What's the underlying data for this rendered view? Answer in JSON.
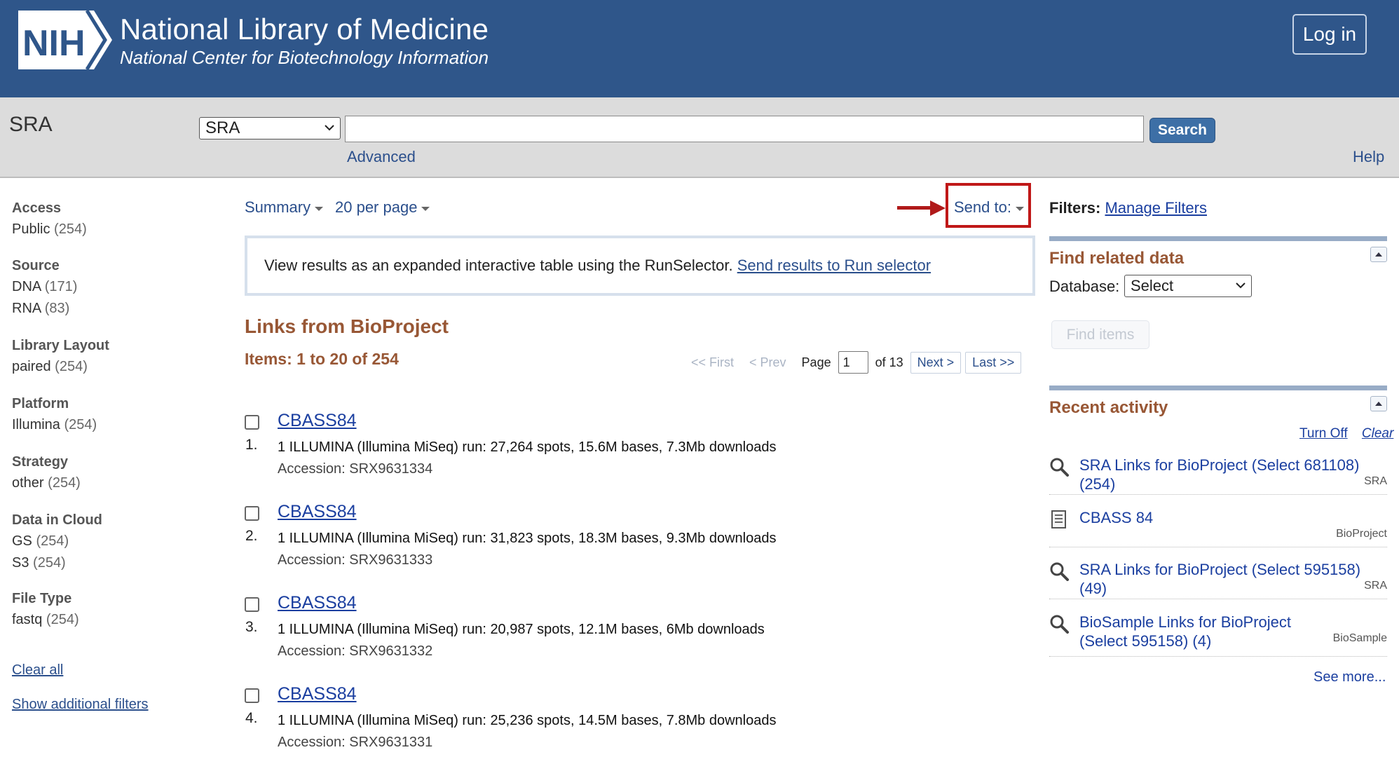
{
  "header": {
    "logo_text": "NIH",
    "title": "National Library of Medicine",
    "subtitle": "National Center for Biotechnology Information",
    "login_label": "Log in"
  },
  "search": {
    "db_heading": "SRA",
    "db_selected": "SRA",
    "query_value": "",
    "search_label": "Search",
    "advanced_label": "Advanced",
    "help_label": "Help"
  },
  "filters": [
    {
      "title": "Access",
      "items": [
        {
          "label": "Public",
          "count": "(254)"
        }
      ]
    },
    {
      "title": "Source",
      "items": [
        {
          "label": "DNA",
          "count": "(171)"
        },
        {
          "label": "RNA",
          "count": "(83)"
        }
      ]
    },
    {
      "title": "Library Layout",
      "items": [
        {
          "label": "paired",
          "count": "(254)"
        }
      ]
    },
    {
      "title": "Platform",
      "items": [
        {
          "label": "Illumina",
          "count": "(254)"
        }
      ]
    },
    {
      "title": "Strategy",
      "items": [
        {
          "label": "other",
          "count": "(254)"
        }
      ]
    },
    {
      "title": "Data in Cloud",
      "items": [
        {
          "label": "GS",
          "count": "(254)"
        },
        {
          "label": "S3",
          "count": "(254)"
        }
      ]
    },
    {
      "title": "File Type",
      "items": [
        {
          "label": "fastq",
          "count": "(254)"
        }
      ]
    }
  ],
  "filter_links": {
    "clear_all": "Clear all",
    "show_additional": "Show additional filters"
  },
  "toolbar": {
    "format": "Summary",
    "per_page": "20 per page",
    "send_to": "Send to:"
  },
  "runselector": {
    "text": "View results as an expanded interactive table using the RunSelector. ",
    "link": "Send results to Run selector"
  },
  "results_header": {
    "title": "Links from BioProject",
    "count": "Items: 1 to 20 of 254"
  },
  "pager": {
    "first": "<< First",
    "prev": "< Prev",
    "page_label": "Page",
    "page_value": "1",
    "of_label": "of 13",
    "next": "Next >",
    "last": "Last >>"
  },
  "results": [
    {
      "num": "1.",
      "title": "CBASS84",
      "desc": "1 ILLUMINA (Illumina MiSeq) run: 27,264 spots, 15.6M bases, 7.3Mb downloads",
      "accession": "Accession: SRX9631334"
    },
    {
      "num": "2.",
      "title": "CBASS84",
      "desc": "1 ILLUMINA (Illumina MiSeq) run: 31,823 spots, 18.3M bases, 9.3Mb downloads",
      "accession": "Accession: SRX9631333"
    },
    {
      "num": "3.",
      "title": "CBASS84",
      "desc": "1 ILLUMINA (Illumina MiSeq) run: 20,987 spots, 12.1M bases, 6Mb downloads",
      "accession": "Accession: SRX9631332"
    },
    {
      "num": "4.",
      "title": "CBASS84",
      "desc": "1 ILLUMINA (Illumina MiSeq) run: 25,236 spots, 14.5M bases, 7.8Mb downloads",
      "accession": "Accession: SRX9631331"
    }
  ],
  "right": {
    "filters_label": "Filters:",
    "manage_filters": "Manage Filters",
    "find_related_title": "Find related data",
    "database_label": "Database:",
    "database_selected": "Select",
    "find_items": "Find items",
    "recent_title": "Recent activity",
    "turn_off": "Turn Off",
    "clear": "Clear",
    "recent": [
      {
        "icon": "search-icon",
        "text": "SRA Links for BioProject (Select 681108) (254)",
        "db": "SRA"
      },
      {
        "icon": "document-icon",
        "text": "CBASS 84",
        "db": "BioProject"
      },
      {
        "icon": "search-icon",
        "text": "SRA Links for BioProject (Select 595158) (49)",
        "db": "SRA"
      },
      {
        "icon": "search-icon",
        "text": "BioSample Links for BioProject (Select 595158) (4)",
        "db": "BioSample"
      }
    ],
    "see_more": "See more..."
  },
  "colors": {
    "header_bg": "#2f568a",
    "accent_brown": "#985735",
    "link_blue": "#1b3fa0",
    "highlight_red": "#c01818"
  }
}
